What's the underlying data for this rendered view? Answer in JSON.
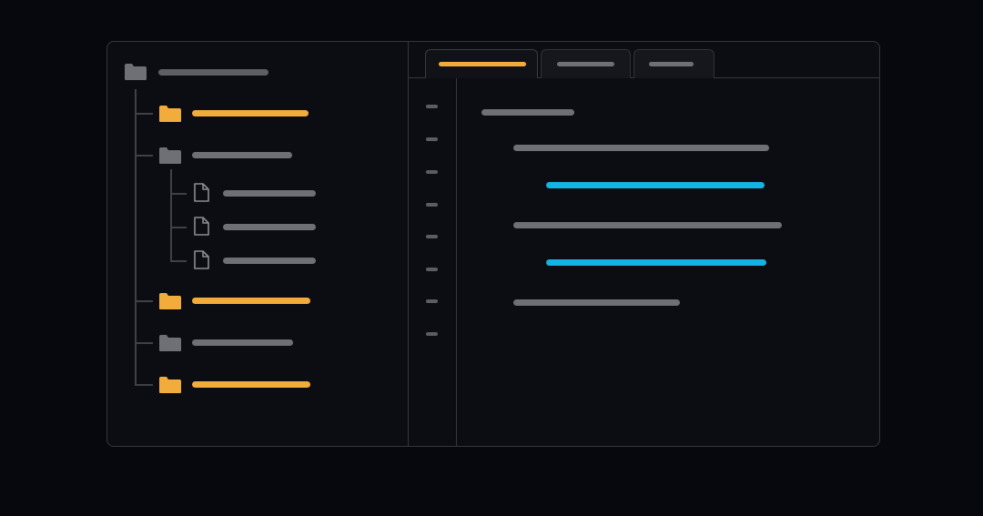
{
  "colors": {
    "background": "#07080d",
    "panel": "#0c0d12",
    "border": "#34363d",
    "accent_folder": "#f2ac3b",
    "muted": "#6e7076",
    "code_highlight": "#13b4e2"
  },
  "explorer": {
    "root": {
      "icon": "folder-icon",
      "color": "muted"
    },
    "items": [
      {
        "kind": "folder",
        "icon": "folder-icon",
        "color": "accent_folder",
        "depth": 1
      },
      {
        "kind": "folder",
        "icon": "folder-icon",
        "color": "muted",
        "depth": 1,
        "expanded": true
      },
      {
        "kind": "file",
        "icon": "file-icon",
        "color": "muted",
        "depth": 2
      },
      {
        "kind": "file",
        "icon": "file-icon",
        "color": "muted",
        "depth": 2
      },
      {
        "kind": "file",
        "icon": "file-icon",
        "color": "muted",
        "depth": 2
      },
      {
        "kind": "folder",
        "icon": "folder-icon",
        "color": "accent_folder",
        "depth": 1
      },
      {
        "kind": "folder",
        "icon": "folder-icon",
        "color": "muted",
        "depth": 1
      },
      {
        "kind": "folder",
        "icon": "folder-icon",
        "color": "accent_folder",
        "depth": 1
      }
    ]
  },
  "editor": {
    "tabs": [
      {
        "active": true,
        "color": "accent_folder"
      },
      {
        "active": false,
        "color": "muted"
      },
      {
        "active": false,
        "color": "muted"
      }
    ],
    "line_count": 8,
    "code_lines": [
      {
        "indent": 0,
        "color": "muted"
      },
      {
        "indent": 1,
        "color": "muted"
      },
      {
        "indent": 2,
        "color": "code_highlight"
      },
      {
        "indent": 1,
        "color": "muted"
      },
      {
        "indent": 2,
        "color": "code_highlight"
      },
      {
        "indent": 1,
        "color": "muted"
      }
    ]
  }
}
